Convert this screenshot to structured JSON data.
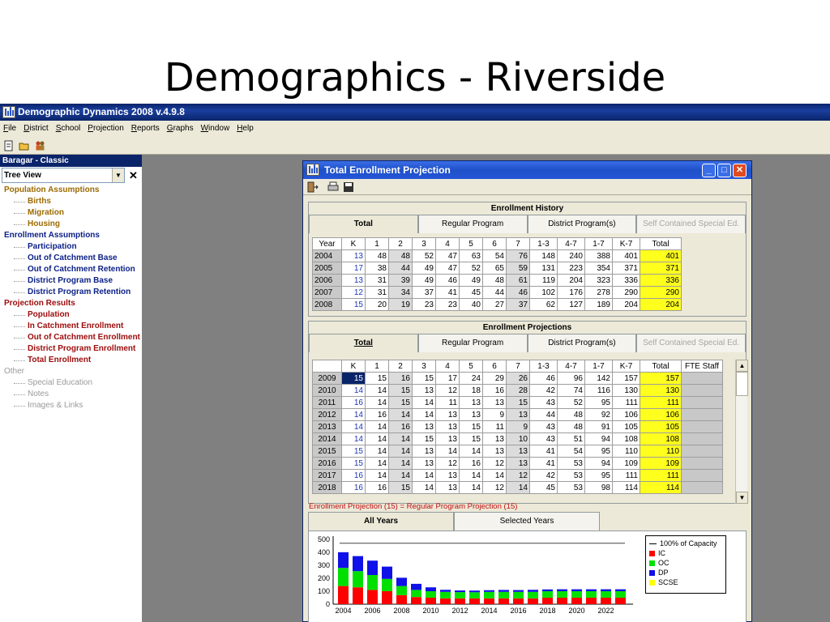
{
  "slide": {
    "title": "Demographics - Riverside"
  },
  "app": {
    "title": "Demographic Dynamics 2008 v.4.9.8",
    "menu": [
      "File",
      "District",
      "School",
      "Projection",
      "Reports",
      "Graphs",
      "Window",
      "Help"
    ],
    "toolbar_icons": [
      "new-document-icon",
      "open-folder-icon",
      "people-icon"
    ]
  },
  "sidebar": {
    "title": "Baragar - Classic",
    "view_select": "Tree View",
    "close_glyph": "✕",
    "tree": [
      {
        "label": "Population Assumptions",
        "level": 1,
        "color": "gold"
      },
      {
        "label": "Births",
        "level": 2,
        "color": "gold"
      },
      {
        "label": "Migration",
        "level": 2,
        "color": "gold"
      },
      {
        "label": "Housing",
        "level": 2,
        "color": "gold"
      },
      {
        "label": "Enrollment Assumptions",
        "level": 1,
        "color": "navy"
      },
      {
        "label": "Participation",
        "level": 2,
        "color": "navy"
      },
      {
        "label": "Out of Catchment Base",
        "level": 2,
        "color": "navy"
      },
      {
        "label": "Out of Catchment Retention",
        "level": 2,
        "color": "navy"
      },
      {
        "label": "District Program Base",
        "level": 2,
        "color": "navy"
      },
      {
        "label": "District Program Retention",
        "level": 2,
        "color": "navy"
      },
      {
        "label": "Projection Results",
        "level": 1,
        "color": "red"
      },
      {
        "label": "Population",
        "level": 2,
        "color": "red"
      },
      {
        "label": "In Catchment Enrollment",
        "level": 2,
        "color": "red"
      },
      {
        "label": "Out of Catchment Enrollment",
        "level": 2,
        "color": "red"
      },
      {
        "label": "District Program Enrollment",
        "level": 2,
        "color": "red"
      },
      {
        "label": "Total Enrollment",
        "level": 2,
        "color": "red"
      },
      {
        "label": "Other",
        "level": 1,
        "color": "gray"
      },
      {
        "label": "Special Education",
        "level": 2,
        "color": "gray"
      },
      {
        "label": "Notes",
        "level": 2,
        "color": "gray"
      },
      {
        "label": "Images & Links",
        "level": 2,
        "color": "gray"
      }
    ]
  },
  "window": {
    "title": "Total Enrollment Projection",
    "toolbar_icons": [
      "exit-icon",
      "print-icon",
      "save-icon"
    ],
    "history": {
      "title": "Enrollment History",
      "tabs": [
        "Total",
        "Regular Program",
        "District Program(s)",
        "Self Contained Special Ed."
      ],
      "columns": [
        "Year",
        "K",
        "1",
        "2",
        "3",
        "4",
        "5",
        "6",
        "7",
        "1-3",
        "4-7",
        "1-7",
        "K-7",
        "Total"
      ],
      "rows": [
        [
          "2004",
          "13",
          "48",
          "48",
          "52",
          "47",
          "63",
          "54",
          "76",
          "148",
          "240",
          "388",
          "401",
          "401"
        ],
        [
          "2005",
          "17",
          "38",
          "44",
          "49",
          "47",
          "52",
          "65",
          "59",
          "131",
          "223",
          "354",
          "371",
          "371"
        ],
        [
          "2006",
          "13",
          "31",
          "39",
          "49",
          "46",
          "49",
          "48",
          "61",
          "119",
          "204",
          "323",
          "336",
          "336"
        ],
        [
          "2007",
          "12",
          "31",
          "34",
          "37",
          "41",
          "45",
          "44",
          "46",
          "102",
          "176",
          "278",
          "290",
          "290"
        ],
        [
          "2008",
          "15",
          "20",
          "19",
          "23",
          "23",
          "40",
          "27",
          "37",
          "62",
          "127",
          "189",
          "204",
          "204"
        ]
      ]
    },
    "projections": {
      "title": "Enrollment Projections",
      "tabs": [
        "Total",
        "Regular Program",
        "District Program(s)",
        "Self Contained Special Ed."
      ],
      "columns": [
        "",
        "K",
        "1",
        "2",
        "3",
        "4",
        "5",
        "6",
        "7",
        "1-3",
        "4-7",
        "1-7",
        "K-7",
        "Total",
        "FTE Staff"
      ],
      "rows": [
        [
          "2009",
          "15",
          "15",
          "16",
          "15",
          "17",
          "24",
          "29",
          "26",
          "46",
          "96",
          "142",
          "157",
          "157",
          ""
        ],
        [
          "2010",
          "14",
          "14",
          "15",
          "13",
          "12",
          "18",
          "16",
          "28",
          "42",
          "74",
          "116",
          "130",
          "130",
          ""
        ],
        [
          "2011",
          "16",
          "14",
          "15",
          "14",
          "11",
          "13",
          "13",
          "15",
          "43",
          "52",
          "95",
          "111",
          "111",
          ""
        ],
        [
          "2012",
          "14",
          "16",
          "14",
          "14",
          "13",
          "13",
          "9",
          "13",
          "44",
          "48",
          "92",
          "106",
          "106",
          ""
        ],
        [
          "2013",
          "14",
          "14",
          "16",
          "13",
          "13",
          "15",
          "11",
          "9",
          "43",
          "48",
          "91",
          "105",
          "105",
          ""
        ],
        [
          "2014",
          "14",
          "14",
          "14",
          "15",
          "13",
          "15",
          "13",
          "10",
          "43",
          "51",
          "94",
          "108",
          "108",
          ""
        ],
        [
          "2015",
          "15",
          "14",
          "14",
          "13",
          "14",
          "14",
          "13",
          "13",
          "41",
          "54",
          "95",
          "110",
          "110",
          ""
        ],
        [
          "2016",
          "15",
          "14",
          "14",
          "13",
          "12",
          "16",
          "12",
          "13",
          "41",
          "53",
          "94",
          "109",
          "109",
          ""
        ],
        [
          "2017",
          "16",
          "14",
          "14",
          "14",
          "13",
          "14",
          "14",
          "12",
          "42",
          "53",
          "95",
          "111",
          "111",
          ""
        ],
        [
          "2018",
          "16",
          "16",
          "15",
          "14",
          "13",
          "14",
          "12",
          "14",
          "45",
          "53",
          "98",
          "114",
          "114",
          ""
        ]
      ]
    },
    "formula_text": "Enrollment Projection (15) = Regular Program Projection (15)",
    "chart_tabs": [
      "All Years",
      "Selected Years"
    ]
  },
  "colors": {
    "IC": "#ff0000",
    "OC": "#00e000",
    "DP": "#1010e8",
    "SCSE": "#ffff00"
  },
  "chart_data": {
    "type": "bar",
    "stacked": true,
    "x": [
      2004,
      2005,
      2006,
      2007,
      2008,
      2009,
      2010,
      2011,
      2012,
      2013,
      2014,
      2015,
      2016,
      2017,
      2018,
      2019,
      2020,
      2021,
      2022,
      2023
    ],
    "xticks": [
      "2004",
      "2006",
      "2008",
      "2010",
      "2012",
      "2014",
      "2016",
      "2018",
      "2020",
      "2022"
    ],
    "yticks": [
      "500",
      "400",
      "300",
      "200",
      "100",
      "0"
    ],
    "ylim": [
      0,
      500
    ],
    "capacity": 470,
    "legend": [
      "100% of Capacity",
      "IC",
      "OC",
      "DP",
      "SCSE"
    ],
    "series": [
      {
        "name": "IC",
        "values": [
          140,
          130,
          110,
          100,
          70,
          55,
          50,
          45,
          45,
          45,
          45,
          45,
          45,
          45,
          50,
          50,
          50,
          50,
          50,
          50
        ]
      },
      {
        "name": "OC",
        "values": [
          140,
          125,
          115,
          95,
          70,
          55,
          50,
          50,
          48,
          47,
          50,
          50,
          50,
          50,
          50,
          50,
          50,
          50,
          50,
          50
        ]
      },
      {
        "name": "DP",
        "values": [
          121,
          116,
          111,
          95,
          64,
          47,
          30,
          16,
          13,
          13,
          13,
          15,
          14,
          16,
          14,
          15,
          15,
          15,
          15,
          15
        ]
      },
      {
        "name": "SCSE",
        "values": [
          0,
          0,
          0,
          0,
          0,
          0,
          0,
          0,
          0,
          0,
          0,
          0,
          0,
          0,
          0,
          0,
          0,
          0,
          0,
          0
        ]
      }
    ]
  }
}
